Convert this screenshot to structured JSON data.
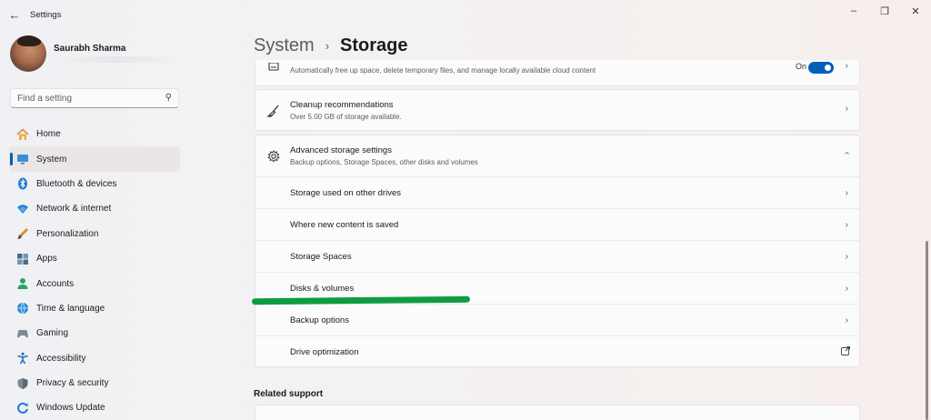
{
  "window": {
    "title": "Settings",
    "back_icon": "←",
    "minimize": "–",
    "maximize": "❐",
    "close": "✕"
  },
  "profile": {
    "name": "Saurabh Sharma"
  },
  "search": {
    "placeholder": "Find a setting",
    "icon": "⚲"
  },
  "nav": {
    "items": [
      {
        "label": "Home",
        "icon": "home-icon"
      },
      {
        "label": "System",
        "icon": "system-icon"
      },
      {
        "label": "Bluetooth & devices",
        "icon": "bluetooth-icon"
      },
      {
        "label": "Network & internet",
        "icon": "network-icon"
      },
      {
        "label": "Personalization",
        "icon": "personalization-icon"
      },
      {
        "label": "Apps",
        "icon": "apps-icon"
      },
      {
        "label": "Accounts",
        "icon": "accounts-icon"
      },
      {
        "label": "Time & language",
        "icon": "time-language-icon"
      },
      {
        "label": "Gaming",
        "icon": "gaming-icon"
      },
      {
        "label": "Accessibility",
        "icon": "accessibility-icon"
      },
      {
        "label": "Privacy & security",
        "icon": "privacy-security-icon"
      },
      {
        "label": "Windows Update",
        "icon": "windows-update-icon"
      }
    ],
    "active_index": 1
  },
  "breadcrumb": {
    "parent": "System",
    "separator": "›",
    "current": "Storage"
  },
  "storage_sense": {
    "subtitle": "Automatically free up space, delete temporary files, and manage locally available cloud content",
    "toggle_label": "On",
    "toggle_on": true
  },
  "cleanup": {
    "title": "Cleanup recommendations",
    "subtitle": "Over 5.00 GB of storage available."
  },
  "advanced": {
    "title": "Advanced storage settings",
    "subtitle": "Backup options, Storage Spaces, other disks and volumes",
    "expanded": true,
    "items": [
      {
        "label": "Storage used on other drives",
        "icon": "chevron-right-icon"
      },
      {
        "label": "Where new content is saved",
        "icon": "chevron-right-icon"
      },
      {
        "label": "Storage Spaces",
        "icon": "chevron-right-icon"
      },
      {
        "label": "Disks & volumes",
        "icon": "chevron-right-icon"
      },
      {
        "label": "Backup options",
        "icon": "chevron-right-icon"
      },
      {
        "label": "Drive optimization",
        "icon": "external-link-icon"
      }
    ]
  },
  "related_support": {
    "title": "Related support"
  },
  "colors": {
    "accent": "#005fb8",
    "annotation_underline": "#0e9c42"
  }
}
